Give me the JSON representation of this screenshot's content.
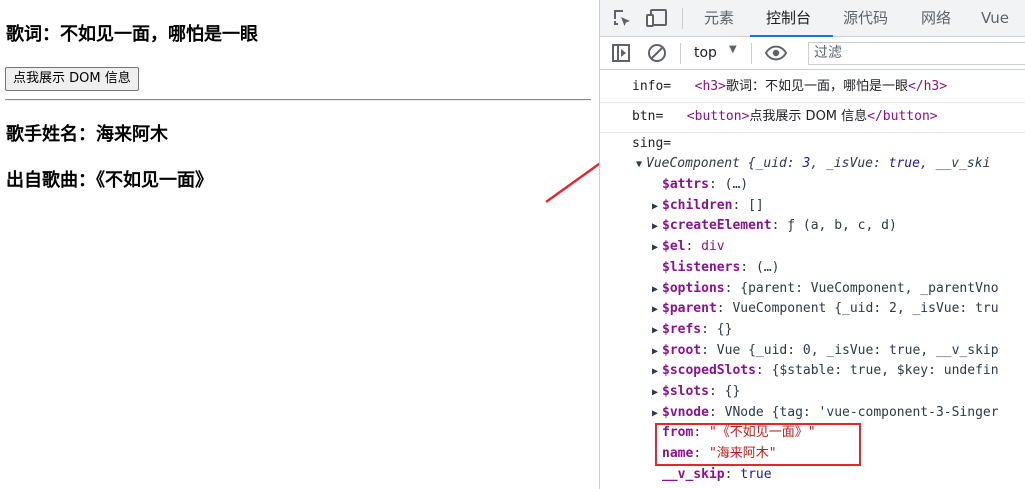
{
  "page": {
    "lyrics_heading": "歌词：不如见一面，哪怕是一眼",
    "dom_button_label": "点我展示 DOM 信息",
    "singer_heading": "歌手姓名：海来阿木",
    "song_source_heading": "出自歌曲：《不如见一面》"
  },
  "devtools": {
    "tabs": [
      "元素",
      "控制台",
      "源代码",
      "网络",
      "Vue"
    ],
    "active_tab": "控制台",
    "context_selector": "top",
    "filter_placeholder": "过滤",
    "accent_color": "#1a73e8"
  },
  "console": {
    "info_label": "info=",
    "info_html": {
      "open": "<h3>",
      "text": "歌词：不如见一面，哪怕是一眼",
      "close": "</h3>"
    },
    "btn_label": "btn=",
    "btn_html": {
      "open": "<button>",
      "text": "点我展示 DOM 信息",
      "close": "</button>"
    },
    "sing_label": "sing=",
    "component_header": {
      "name": "VueComponent",
      "preview_prefix": " {_uid: ",
      "uid": "3",
      "preview_mid": ", _isVue: ",
      "is_vue": "true",
      "preview_tail": ", __v_ski"
    },
    "properties": [
      {
        "key": "$attrs",
        "value": "(…)",
        "expandable": false
      },
      {
        "key": "$children",
        "value": "[]",
        "expandable": true
      },
      {
        "key": "$createElement",
        "value": "ƒ (a, b, c, d)",
        "expandable": true
      },
      {
        "key": "$el",
        "value": "div",
        "expandable": true
      },
      {
        "key": "$listeners",
        "value": "(…)",
        "expandable": false
      },
      {
        "key": "$options",
        "value": "{parent: VueComponent, _parentVno",
        "expandable": true
      },
      {
        "key": "$parent",
        "value": "VueComponent {_uid: 2, _isVue: tru",
        "expandable": true
      },
      {
        "key": "$refs",
        "value": "{}",
        "expandable": true
      },
      {
        "key": "$root",
        "value": "Vue {_uid: 0, _isVue: true, __v_skip",
        "expandable": true
      },
      {
        "key": "$scopedSlots",
        "value": "{$stable: true, $key: undefin",
        "expandable": true
      },
      {
        "key": "$slots",
        "value": "{}",
        "expandable": true
      },
      {
        "key": "$vnode",
        "value": "VNode {tag: 'vue-component-3-Singer",
        "expandable": true
      },
      {
        "key": "from",
        "value": "\"《不如见一面》\"",
        "expandable": false
      },
      {
        "key": "name",
        "value": "\"海来阿木\"",
        "expandable": false
      },
      {
        "key": "__v_skip",
        "value": "true",
        "expandable": false
      }
    ]
  },
  "annotation_color": "#e3262f"
}
